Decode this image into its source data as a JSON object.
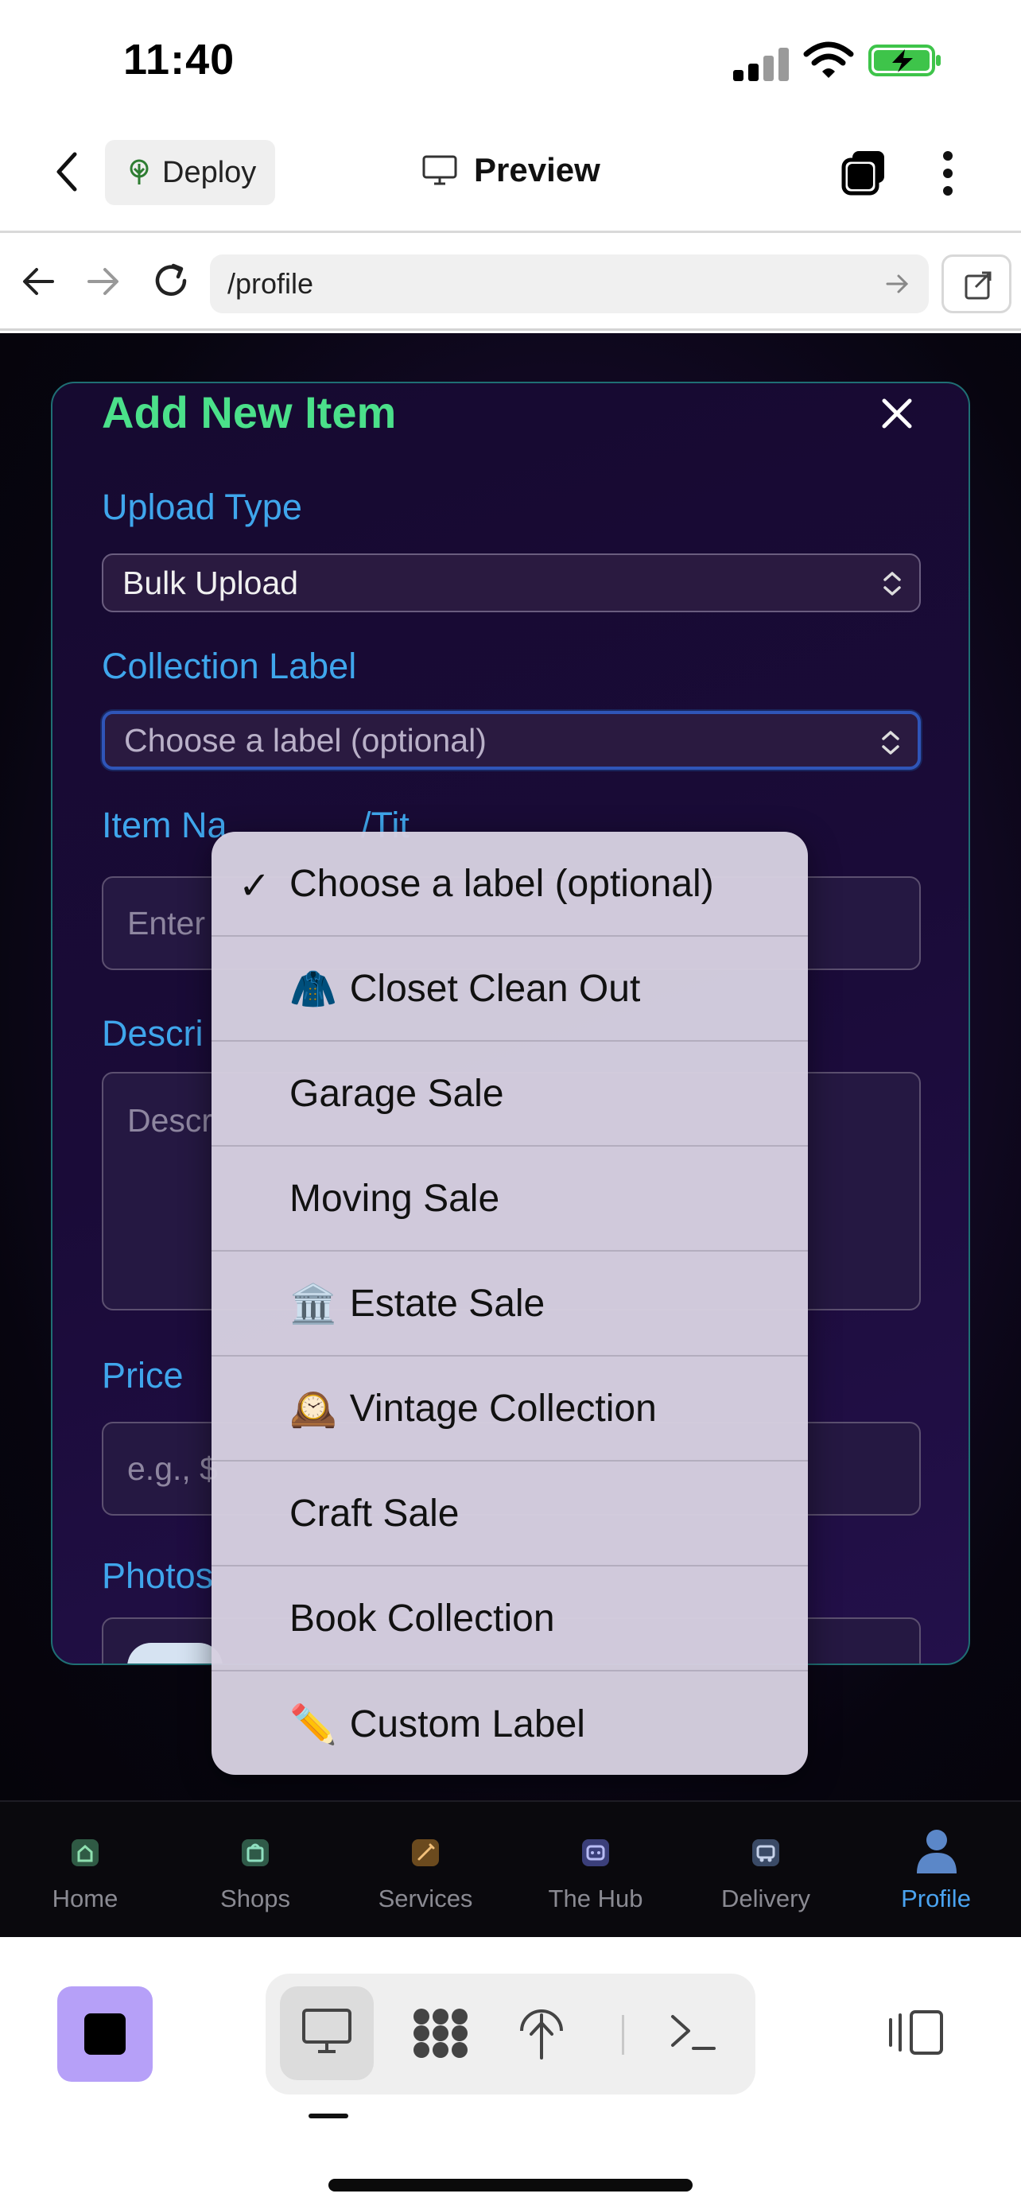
{
  "status_bar": {
    "time": "11:40"
  },
  "app_bar": {
    "deploy_label": "Deploy",
    "preview_label": "Preview"
  },
  "browser": {
    "url": "/profile"
  },
  "modal": {
    "title": "Add New Item",
    "upload_type_label": "Upload Type",
    "upload_type_value": "Bulk Upload",
    "collection_label": "Collection Label",
    "collection_value": "Choose a label (optional)",
    "item_name_label": "Item Na",
    "item_name_label_tail": "/Tit",
    "item_name_placeholder": "Enter",
    "description_label": "Descri",
    "description_placeholder": "Descr",
    "price_label": "Price",
    "price_placeholder": "e.g., $",
    "photos_label": "Photos"
  },
  "picker": {
    "options": [
      {
        "icon": "",
        "label": "Choose a label (optional)",
        "selected": true
      },
      {
        "icon": "🧥",
        "label": "Closet Clean Out",
        "selected": false
      },
      {
        "icon": "",
        "label": "Garage Sale",
        "selected": false
      },
      {
        "icon": "",
        "label": "Moving Sale",
        "selected": false
      },
      {
        "icon": "🏛️",
        "label": "Estate Sale",
        "selected": false
      },
      {
        "icon": "🕰️",
        "label": "Vintage Collection",
        "selected": false
      },
      {
        "icon": "",
        "label": "Craft Sale",
        "selected": false
      },
      {
        "icon": "",
        "label": "Book Collection",
        "selected": false
      },
      {
        "icon": "✏️",
        "label": "Custom Label",
        "selected": false
      }
    ],
    "check_mark": "✓"
  },
  "bottom_nav": {
    "items": [
      {
        "label": "Home",
        "icon": "home-icon"
      },
      {
        "label": "Shops",
        "icon": "shopping-bag-icon"
      },
      {
        "label": "Services",
        "icon": "tools-icon"
      },
      {
        "label": "The Hub",
        "icon": "robot-icon"
      },
      {
        "label": "Delivery",
        "icon": "truck-icon"
      },
      {
        "label": "Profile",
        "icon": "person-icon"
      }
    ],
    "active_index": 5,
    "active_color": "#4aa3f0"
  },
  "colors": {
    "accent_green": "#4be08a",
    "label_blue": "#3fa6ec",
    "stop_purple": "#b6a0f8"
  }
}
